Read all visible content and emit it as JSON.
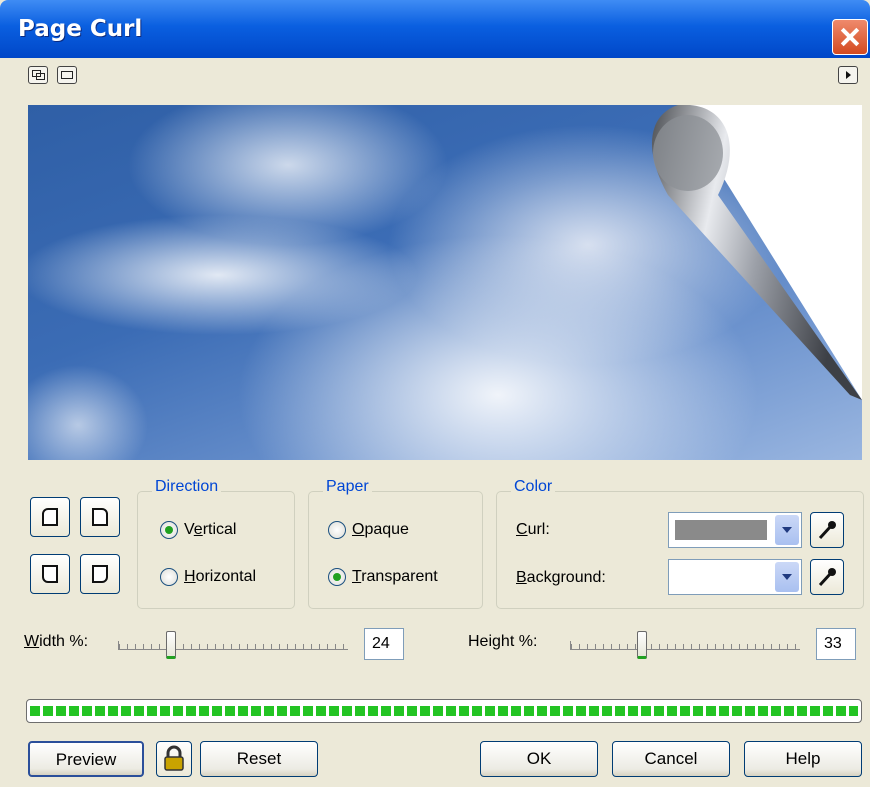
{
  "window": {
    "title": "Page Curl"
  },
  "icons": {
    "close": "close-icon",
    "toolbar_left": [
      "two-page-view-icon",
      "side-by-side-view-icon"
    ],
    "toolbar_right": "flyout-arrow-icon",
    "lock": "lock-icon",
    "eyedropper": "eyedropper-icon"
  },
  "corner_buttons": [
    "top-left-corner",
    "top-right-corner",
    "bottom-left-corner",
    "bottom-right-corner"
  ],
  "direction": {
    "label": "Direction",
    "options": [
      "Vertical",
      "Horizontal"
    ],
    "selected": "Vertical"
  },
  "paper": {
    "label": "Paper",
    "options": [
      "Opaque",
      "Transparent"
    ],
    "selected": "Transparent"
  },
  "color": {
    "label": "Color",
    "curl_label": "Curl:",
    "background_label": "Background:",
    "curl_color": "#8a8a8a",
    "background_color": "#ffffff"
  },
  "width": {
    "label": "Width %:",
    "value": "24"
  },
  "height": {
    "label": "Height %:",
    "value": "33"
  },
  "progress": {
    "value": 1.0,
    "color": "#23c423"
  },
  "buttons": {
    "preview": "Preview",
    "reset": "Reset",
    "ok": "OK",
    "cancel": "Cancel",
    "help": "Help"
  }
}
